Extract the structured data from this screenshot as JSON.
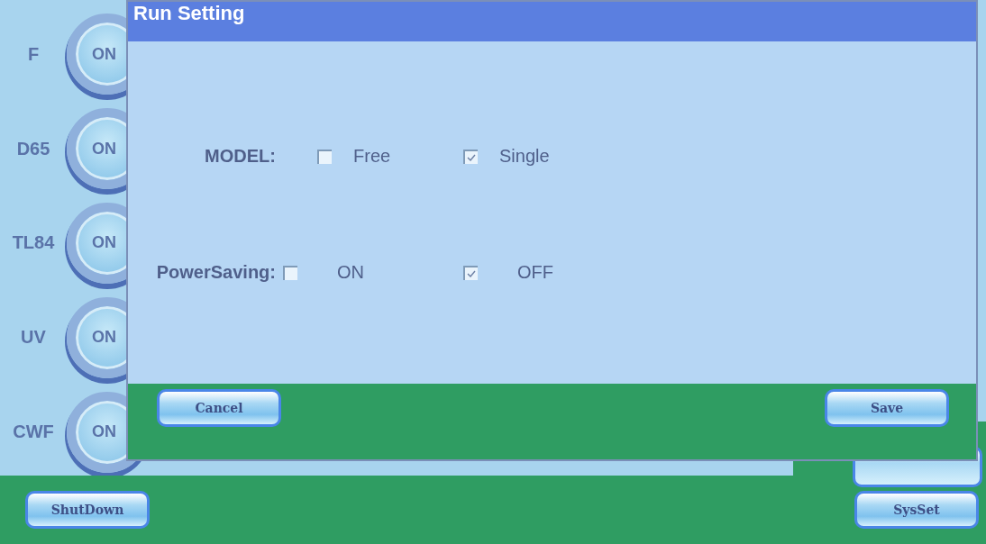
{
  "lamps": [
    {
      "label": "F",
      "button": "ON"
    },
    {
      "label": "D65",
      "button": "ON"
    },
    {
      "label": "TL84",
      "button": "ON"
    },
    {
      "label": "UV",
      "button": "ON"
    },
    {
      "label": "CWF",
      "button": "ON"
    }
  ],
  "bottom_bar": {
    "buttons": [
      "ShutDown",
      "SysSet"
    ]
  },
  "dialog": {
    "title": "Run Setting",
    "rows": [
      {
        "label": "MODEL:",
        "options": [
          {
            "label": "Free",
            "checked": false
          },
          {
            "label": "Single",
            "checked": true
          }
        ]
      },
      {
        "label": "PowerSaving:",
        "options": [
          {
            "label": "ON",
            "checked": false
          },
          {
            "label": "OFF",
            "checked": true
          }
        ]
      }
    ],
    "buttons": [
      "Cancel",
      "Save"
    ]
  }
}
